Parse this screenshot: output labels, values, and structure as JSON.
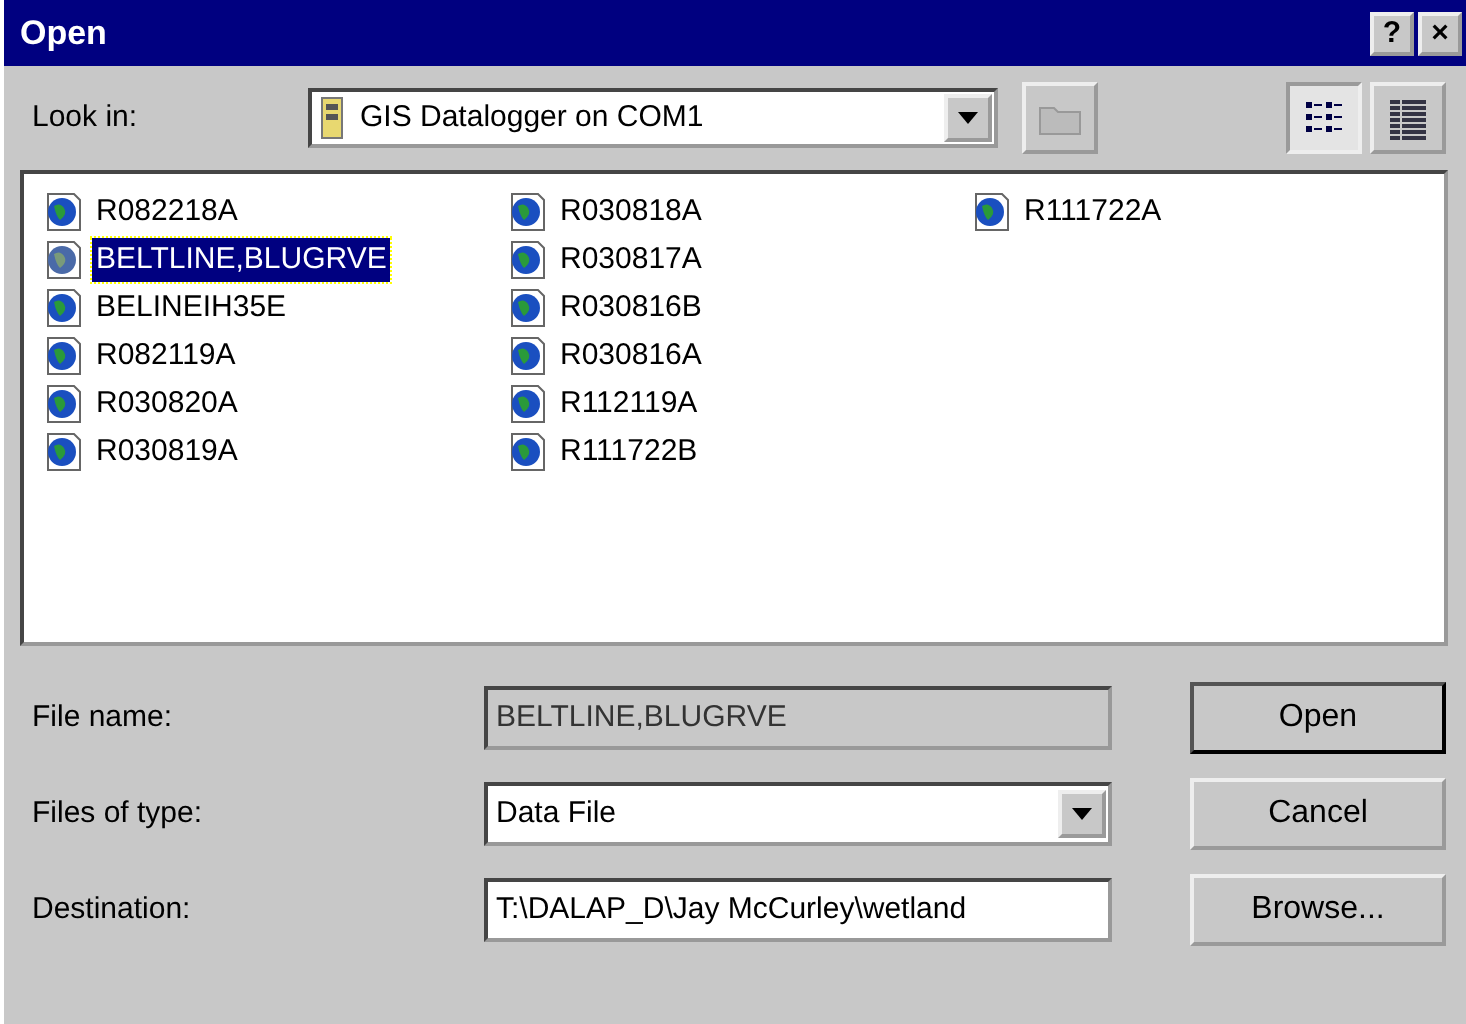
{
  "window": {
    "title": "Open",
    "title_buttons": [
      "?",
      "×"
    ]
  },
  "look_in": {
    "label": "Look in:",
    "value": "GIS Datalogger on COM1"
  },
  "view_buttons": [
    {
      "kind": "list",
      "selected": true
    },
    {
      "kind": "details",
      "selected": false
    }
  ],
  "files": [
    {
      "name": "R082218A",
      "selected": false
    },
    {
      "name": "BELTLINE,BLUGRVE",
      "selected": true
    },
    {
      "name": "BELINEIH35E",
      "selected": false
    },
    {
      "name": "R082119A",
      "selected": false
    },
    {
      "name": "R030820A",
      "selected": false
    },
    {
      "name": "R030819A",
      "selected": false
    },
    {
      "name": "R030818A",
      "selected": false
    },
    {
      "name": "R030817A",
      "selected": false
    },
    {
      "name": "R030816B",
      "selected": false
    },
    {
      "name": "R030816A",
      "selected": false
    },
    {
      "name": "R112119A",
      "selected": false
    },
    {
      "name": "R111722B",
      "selected": false
    },
    {
      "name": "R111722A",
      "selected": false
    }
  ],
  "fields": [
    {
      "kind": "text",
      "label": "File name:",
      "value": "BELTLINE,BLUGRVE",
      "disabled": true,
      "button": "Open"
    },
    {
      "kind": "dropdown",
      "label": "Files of type:",
      "value": "Data File",
      "disabled": false,
      "button": "Cancel"
    },
    {
      "kind": "text",
      "label": "Destination:",
      "value": "T:\\DALAP_D\\Jay McCurley\\wetland",
      "disabled": false,
      "button": "Browse..."
    }
  ]
}
